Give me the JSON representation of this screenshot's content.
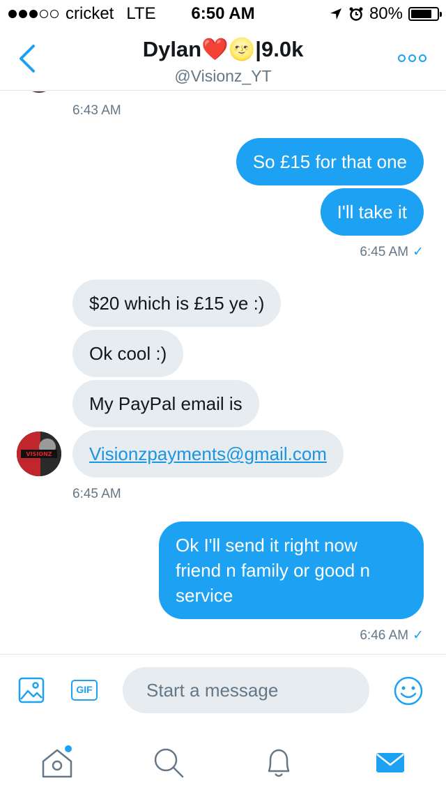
{
  "status_bar": {
    "carrier": "cricket",
    "network": "LTE",
    "time": "6:50 AM",
    "battery": "80%",
    "battery_level": 0.8,
    "signal_bars_filled": 3,
    "signal_bars_total": 5
  },
  "header": {
    "title": "Dylan❤️🌝|9.0k",
    "handle": "@Visionz_YT"
  },
  "messages": [
    {
      "direction": "in",
      "text": "",
      "partial": true
    },
    {
      "timestamp": "6:43 AM"
    },
    {
      "direction": "out",
      "text": "So £15 for that one"
    },
    {
      "direction": "out",
      "text": "I'll take it"
    },
    {
      "timestamp": "6:45 AM",
      "read": true
    },
    {
      "direction": "in",
      "text": "$20 which is £15 ye :)"
    },
    {
      "direction": "in",
      "text": "Ok cool :)"
    },
    {
      "direction": "in",
      "text": "My PayPal email is"
    },
    {
      "direction": "in",
      "text": "Visionzpayments@gmail.com",
      "is_link": true
    },
    {
      "timestamp": "6:45 AM"
    },
    {
      "direction": "out",
      "text": "Ok I'll send it right now friend n family or good n service"
    },
    {
      "timestamp": "6:46 AM",
      "read": true
    }
  ],
  "avatar": {
    "label": "VISIONZ"
  },
  "composer": {
    "placeholder": "Start a message",
    "gif_label": "GIF"
  },
  "tabbar": {
    "items": [
      "home-icon",
      "search-icon",
      "notifications-icon",
      "messages-icon"
    ],
    "active": "messages-icon",
    "home_has_notification_dot": true
  },
  "colors": {
    "accent": "#1da1f2",
    "incoming_bubble": "#e6ecf0",
    "secondary_text": "#657786",
    "link": "#1b95e0"
  }
}
